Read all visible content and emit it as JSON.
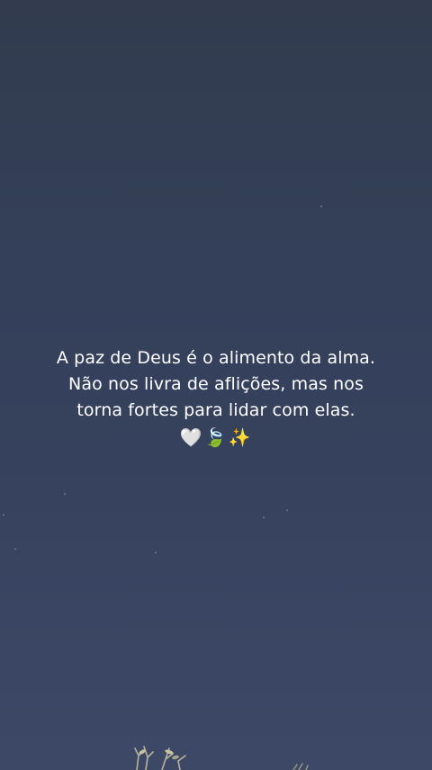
{
  "quote": {
    "line1": "A paz de Deus é o alimento da alma.",
    "line2": "Não nos livra de aflições, mas nos",
    "line3": "torna fortes para lidar com elas.",
    "emojis": "🤍🍃✨"
  },
  "colors": {
    "sky_top": "#323c4e",
    "sky_bottom": "#3d4866",
    "text": "#ffffff"
  }
}
